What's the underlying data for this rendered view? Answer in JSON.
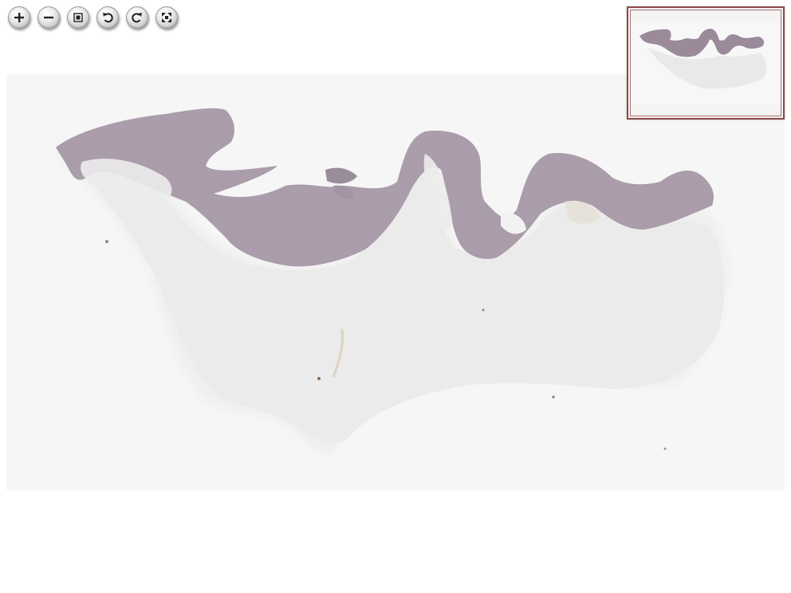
{
  "toolbar": {
    "buttons": [
      {
        "name": "zoom-in",
        "icon": "plus-icon"
      },
      {
        "name": "zoom-out",
        "icon": "minus-icon"
      },
      {
        "name": "home",
        "icon": "home-fit-icon"
      },
      {
        "name": "rotate-left",
        "icon": "rotate-left-icon"
      },
      {
        "name": "rotate-right",
        "icon": "rotate-right-icon"
      },
      {
        "name": "full-page",
        "icon": "fullscreen-icon"
      }
    ]
  },
  "image": {
    "description_icon": "tissue-slide-image"
  },
  "navigator": {
    "border_color": "#8c4a4a"
  },
  "colors": {
    "tissue_stain": "#9a8a96",
    "stroma": "#eeeeee",
    "background": "#f6f6f6"
  }
}
